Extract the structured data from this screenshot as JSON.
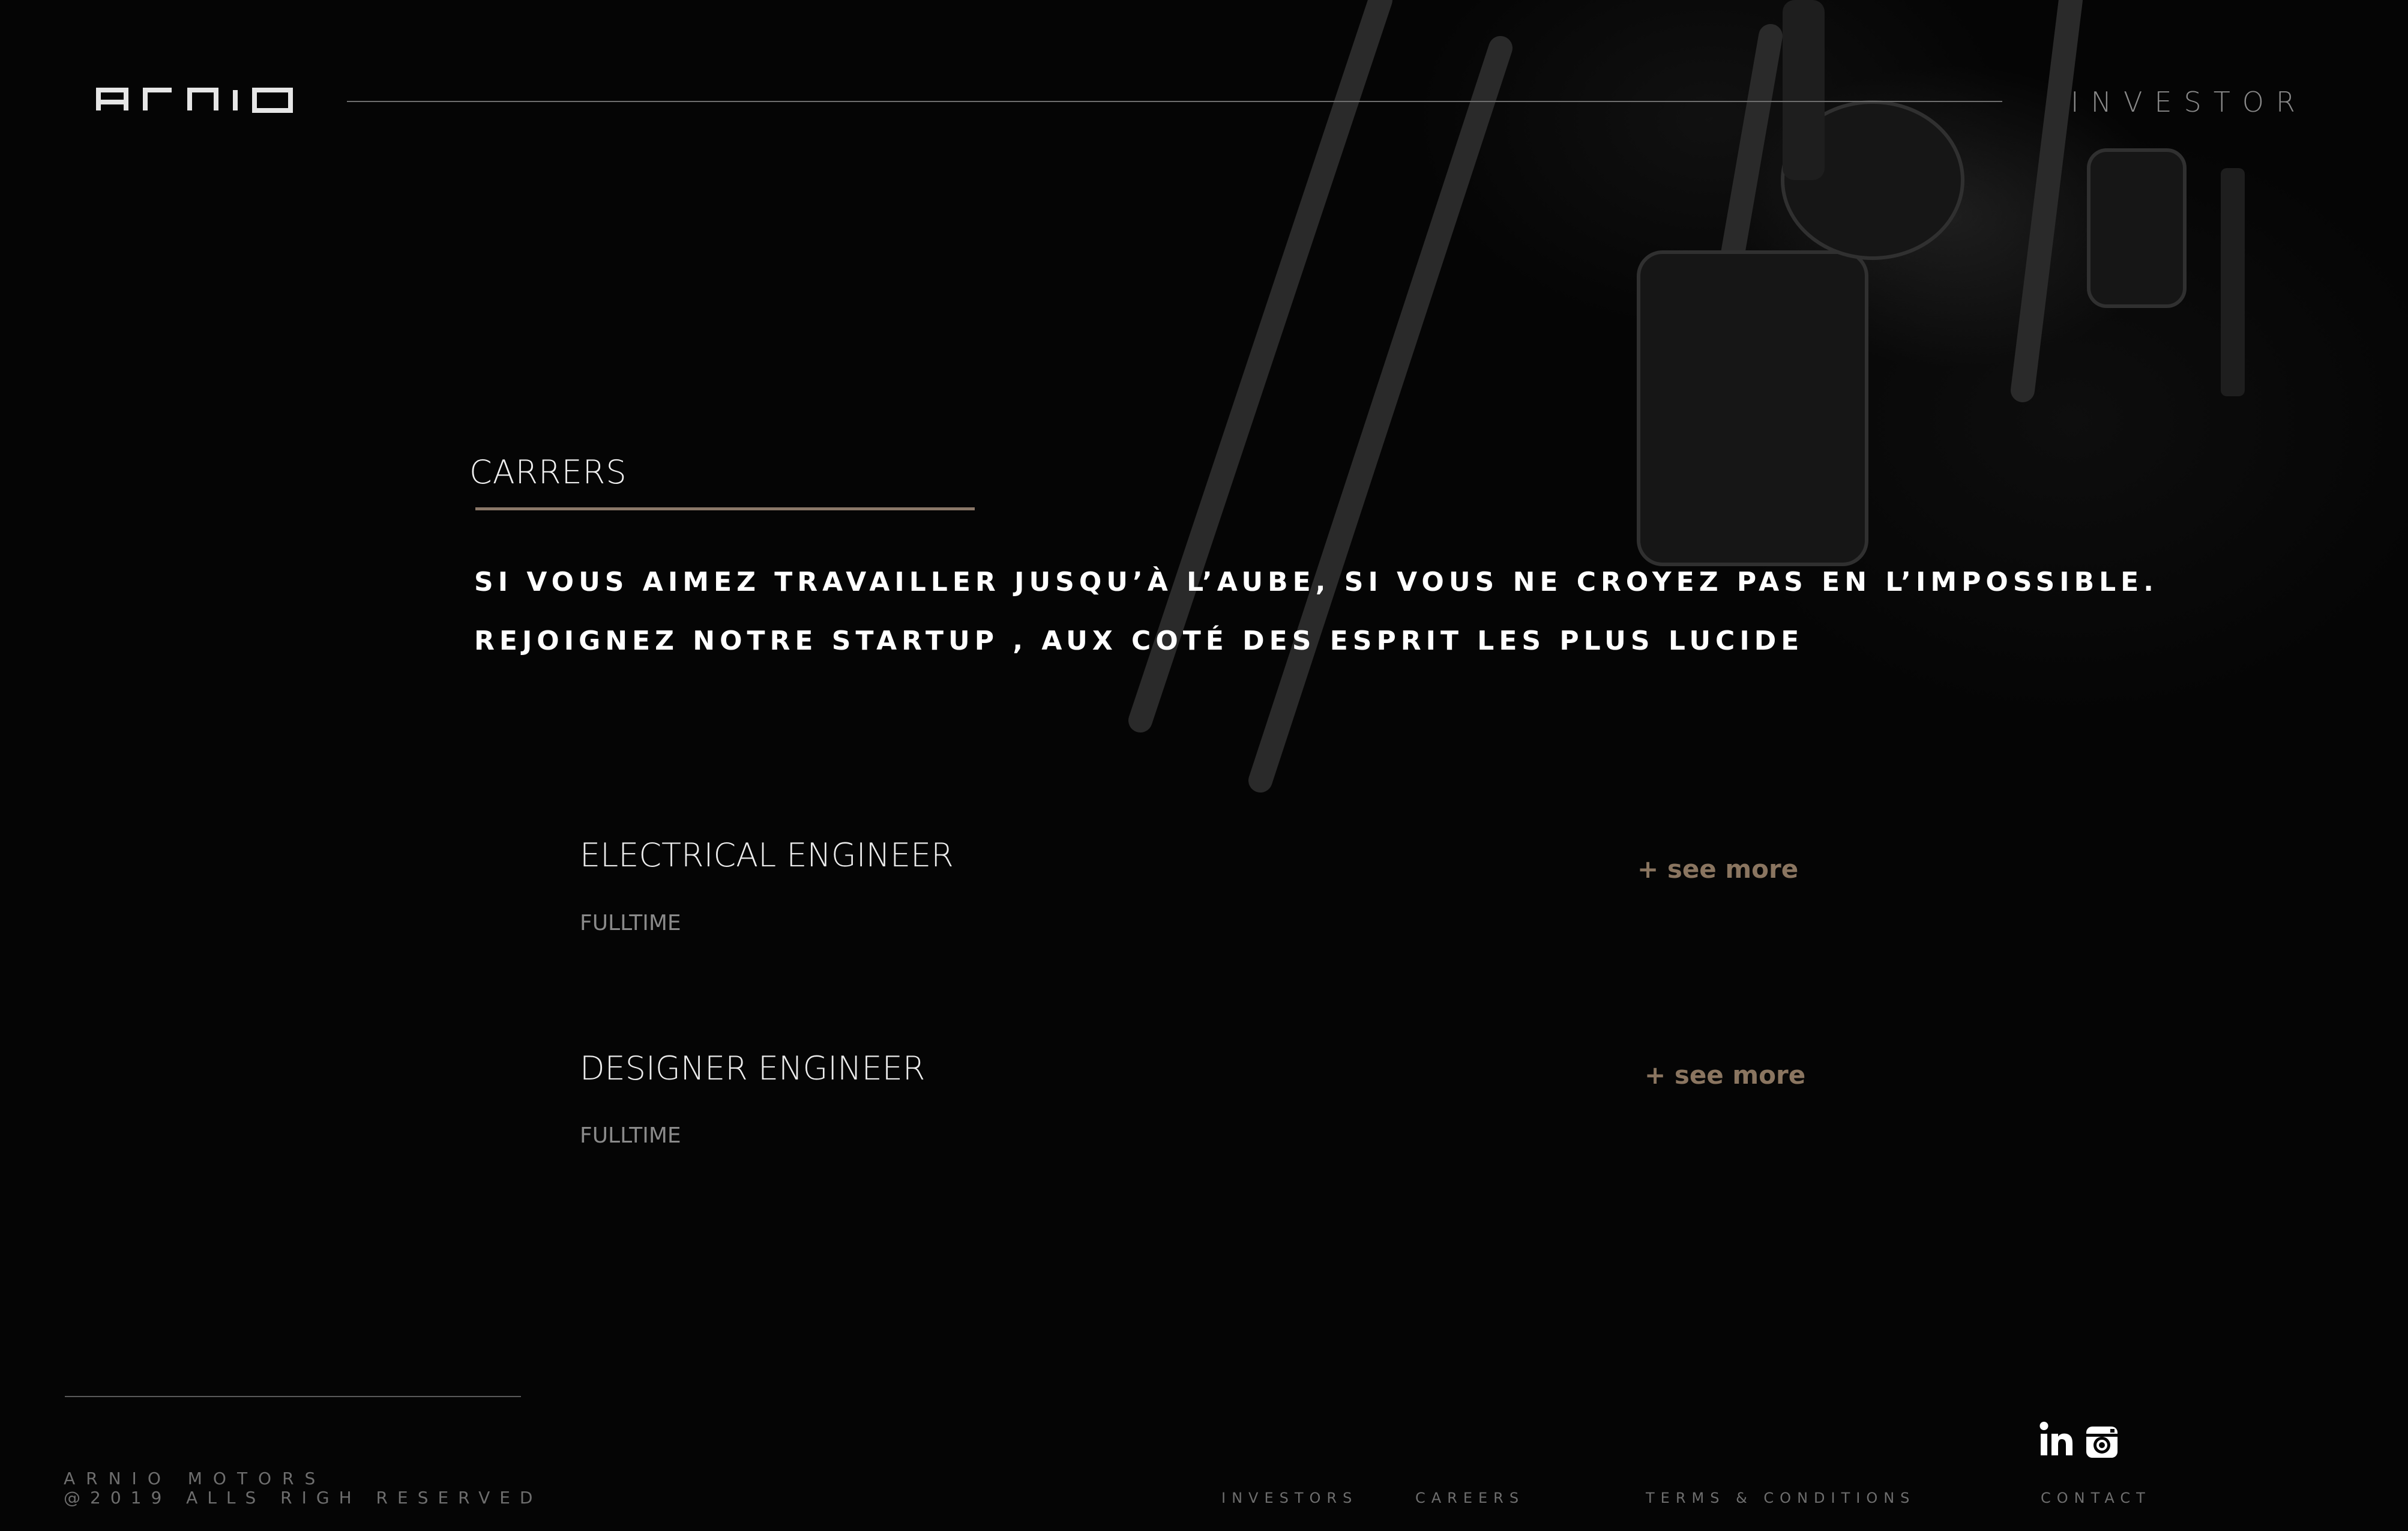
{
  "brand": {
    "logo_text": "ARNIO"
  },
  "header": {
    "investor_label": "INVESTOR"
  },
  "careers": {
    "title": "CARRERS",
    "intro_line_1": "SI VOUS AIMEZ TRAVAILLER JUSQU’À L’AUBE, SI VOUS NE CROYEZ PAS EN L’IMPOSSIBLE.",
    "intro_line_2": "REJOIGNEZ NOTRE STARTUP , AUX COTÉ DES ESPRIT LES PLUS LUCIDE",
    "jobs": [
      {
        "title": "ELECTRICAL ENGINEER",
        "type": "FULLTIME",
        "see_more": "+ see more"
      },
      {
        "title": "DESIGNER ENGINEER",
        "type": "FULLTIME",
        "see_more": "+ see more"
      }
    ]
  },
  "footer": {
    "company": "ARNIO MOTORS",
    "copyright": "@2019 ALLS RIGH RESERVED",
    "nav": [
      "INVESTORS",
      "CAREERS",
      "TERMS & CONDITIONS",
      "CONTACT"
    ],
    "social": [
      {
        "icon": "linkedin-icon",
        "label": "in"
      },
      {
        "icon": "instagram-icon"
      }
    ]
  },
  "colors": {
    "background": "#050505",
    "accent_brown": "#8a7560",
    "muted_text": "#6e6e6e"
  }
}
